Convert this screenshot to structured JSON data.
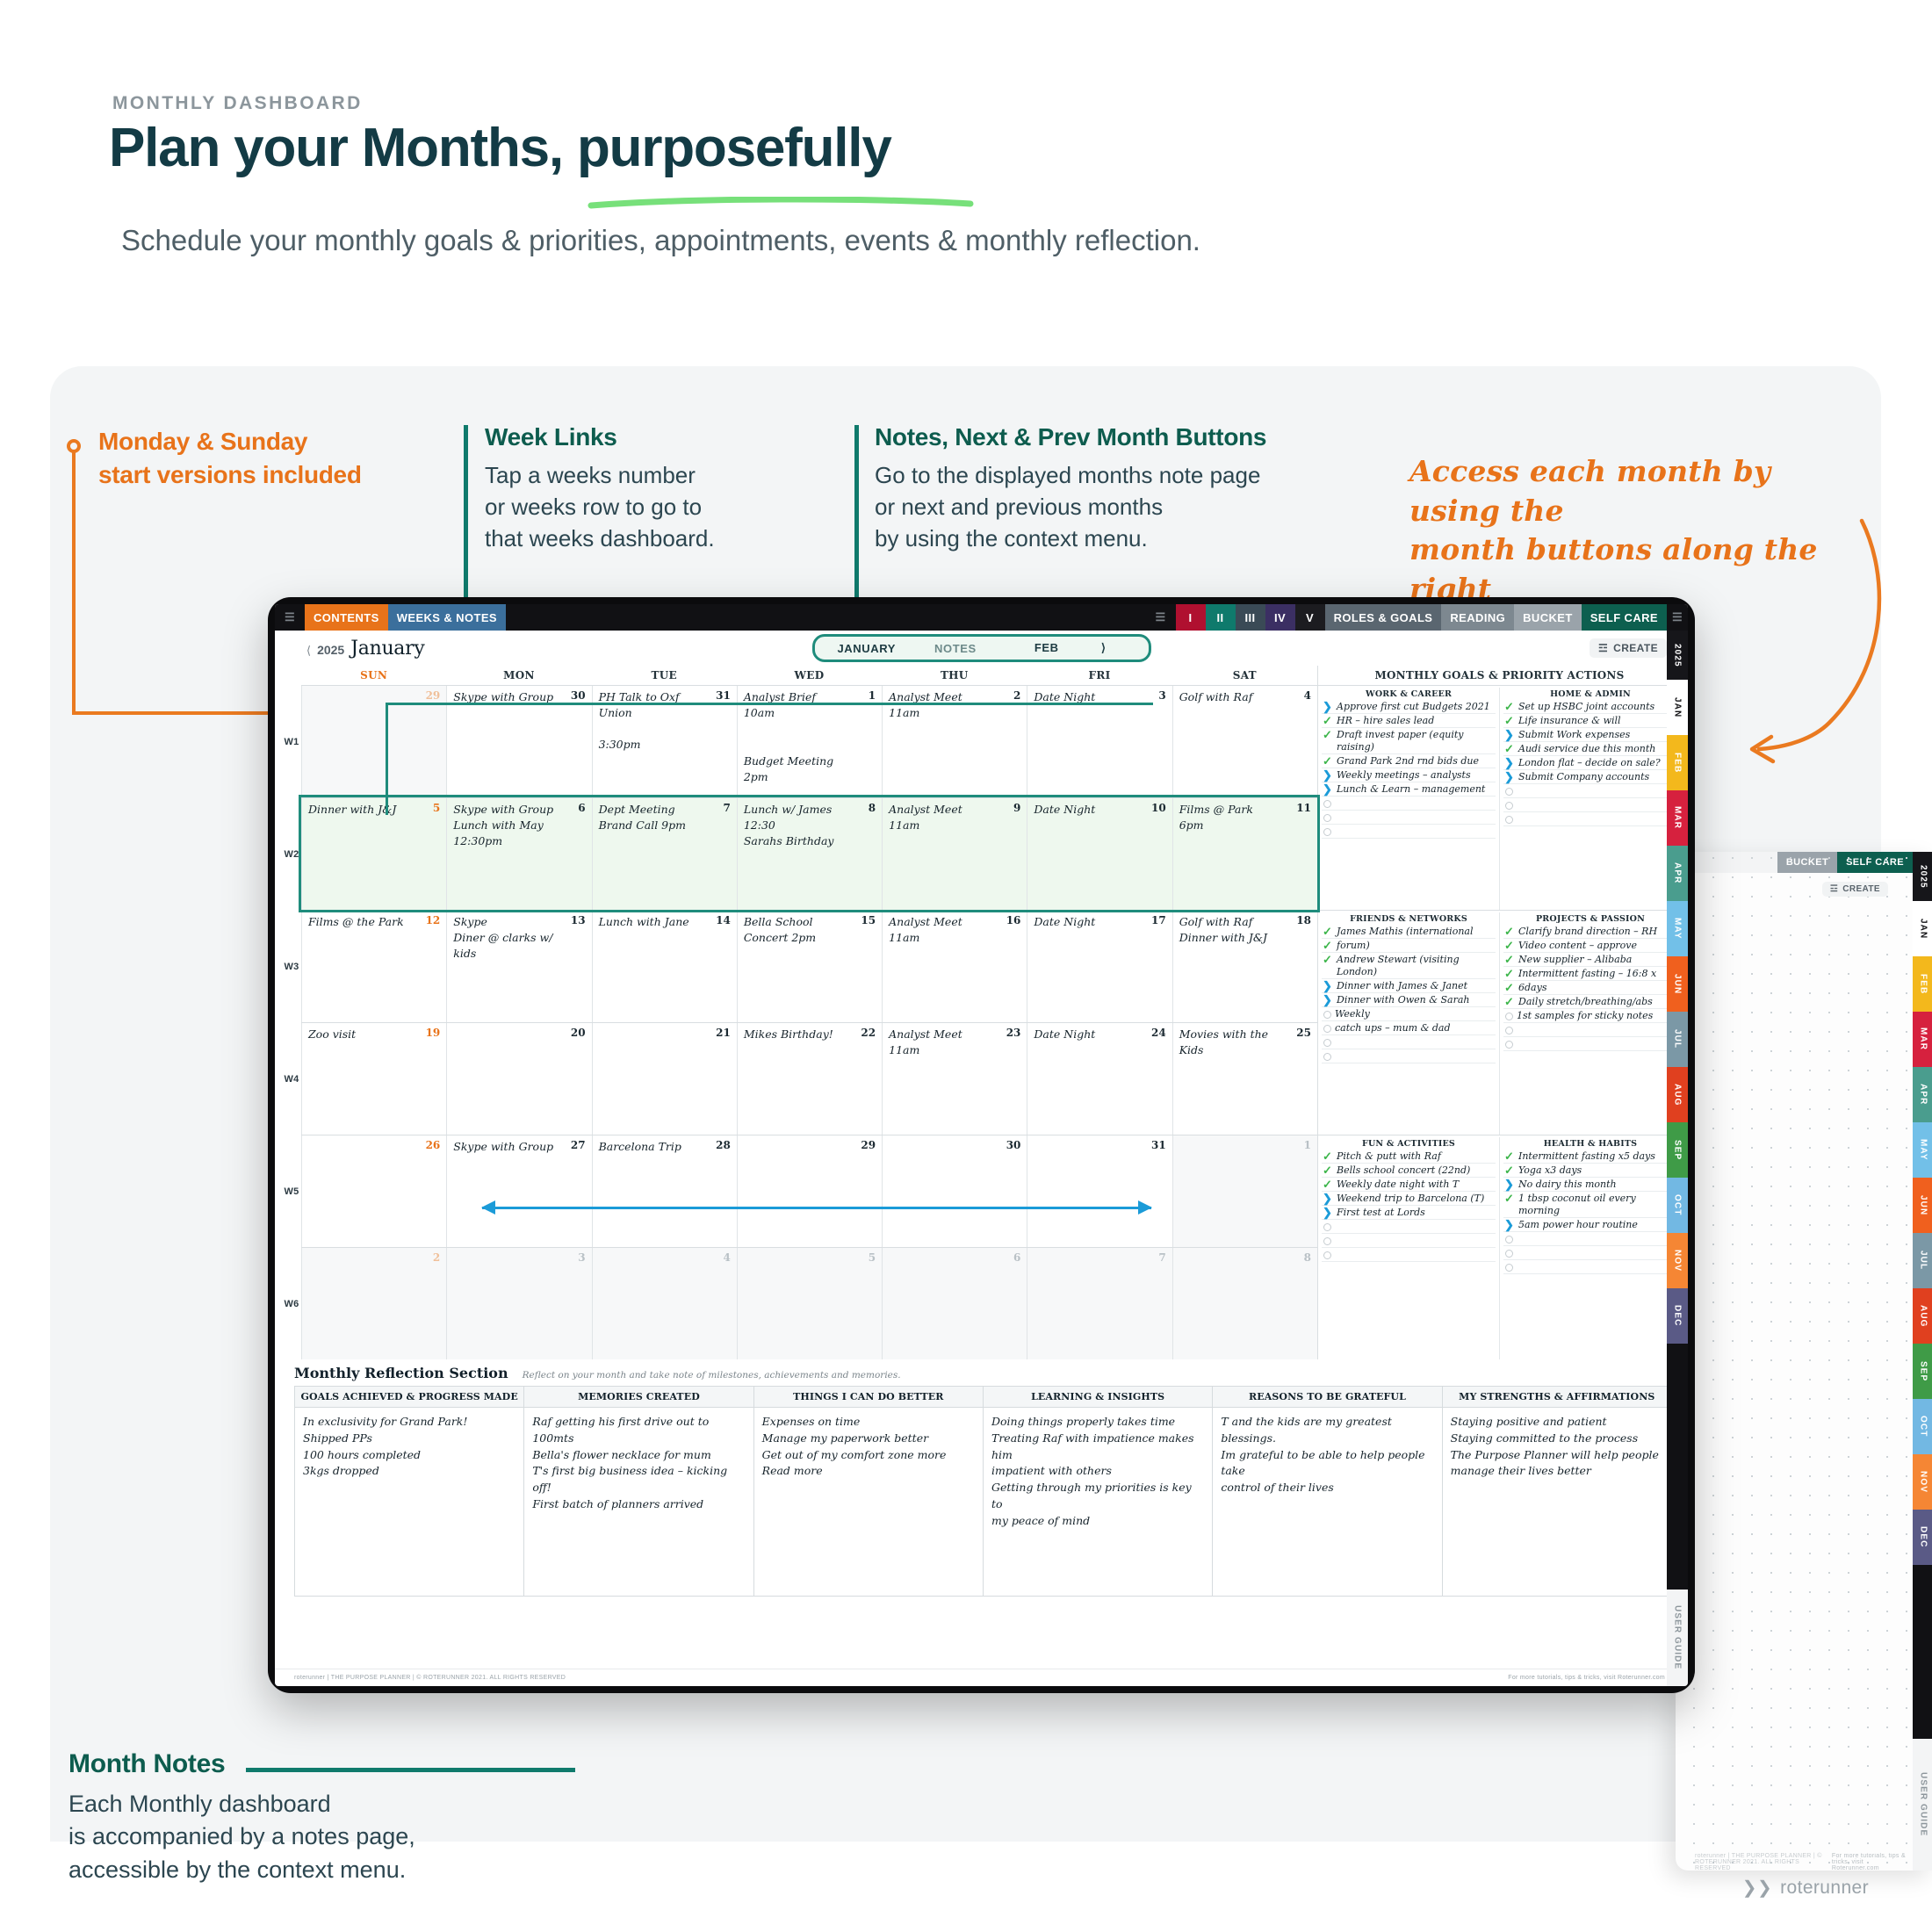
{
  "header": {
    "eyebrow": "MONTHLY DASHBOARD",
    "title": "Plan your Months, purposefully",
    "subtitle": "Schedule your monthly goals & priorities, appointments, events & monthly reflection."
  },
  "callouts": {
    "monday_sunday": {
      "title": "Monday & Sunday\nstart versions included",
      "color": "#e8731a"
    },
    "week_links": {
      "title": "Week Links",
      "body": "Tap a weeks number\nor weeks row to go to\nthat weeks dashboard."
    },
    "notes_buttons": {
      "title": "Notes, Next & Prev Month Buttons",
      "body": "Go to the displayed months note page\nor next and previous months\nby using the context menu."
    },
    "month_access": "Access each month by using the\nmonth buttons along the right",
    "month_notes": {
      "title": "Month Notes",
      "body": "Each Monthly dashboard\nis accompanied by a notes page,\naccessible by the context menu."
    }
  },
  "toolbar": {
    "menu_icon": "hamburger-icon",
    "contents": "CONTENTS",
    "weeks_notes": "WEEKS & NOTES",
    "list_icon": "list-icon",
    "numerals": [
      "I",
      "II",
      "III",
      "IV",
      "V"
    ],
    "roles_goals": "ROLES & GOALS",
    "reading": "READING",
    "bucket": "BUCKET",
    "self_care": "SELF CARE",
    "right_icon": "pages-icon",
    "colors": {
      "contents": "#e8731a",
      "weeks_notes": "#3b6f9c",
      "i": "#b01030",
      "ii": "#0f7a6c",
      "iii": "#3a4a56",
      "iv": "#3b2f63",
      "v": "#1c1c20",
      "roles_goals": "#5a6670",
      "reading": "#7d8890",
      "bucket": "#9aa3aa",
      "self_care": "#0d5f4f"
    }
  },
  "app_header": {
    "year": "2025",
    "year_prev_icon": "chevron-left-icon",
    "month": "January",
    "ctx_current": "JANUARY",
    "ctx_notes": "NOTES",
    "ctx_next": "FEB",
    "ctx_next_icon": "chevron-right-icon",
    "create_label": "CREATE",
    "create_icon": "create-icon"
  },
  "calendar": {
    "day_headers": [
      "SUN",
      "MON",
      "TUE",
      "WED",
      "THU",
      "FRI",
      "SAT"
    ],
    "week_labels": [
      "W1",
      "W2",
      "W3",
      "W4",
      "W5",
      "W6"
    ],
    "weeks": [
      {
        "label": "W1",
        "highlight": false,
        "days": [
          {
            "n": "29",
            "muted": true,
            "events": ""
          },
          {
            "n": "30",
            "muted": false,
            "events": "Skype with Group"
          },
          {
            "n": "31",
            "muted": false,
            "events": "PH Talk to Oxf\nUnion\n\n3:30pm"
          },
          {
            "n": "1",
            "muted": false,
            "events": "Analyst Brief\n10am\n\n\nBudget Meeting 2pm"
          },
          {
            "n": "2",
            "muted": false,
            "events": "Analyst Meet\n11am"
          },
          {
            "n": "3",
            "muted": false,
            "events": "Date Night"
          },
          {
            "n": "4",
            "muted": false,
            "events": "Golf with Raf"
          }
        ]
      },
      {
        "label": "W2",
        "highlight": true,
        "days": [
          {
            "n": "5",
            "muted": false,
            "events": "Dinner with J&J"
          },
          {
            "n": "6",
            "muted": false,
            "events": "Skype with Group\nLunch with May\n12:30pm"
          },
          {
            "n": "7",
            "muted": false,
            "events": "Dept Meeting\nBrand Call 9pm"
          },
          {
            "n": "8",
            "muted": false,
            "events": "Lunch w/ James\n12:30\nSarahs Birthday"
          },
          {
            "n": "9",
            "muted": false,
            "events": "Analyst Meet\n11am"
          },
          {
            "n": "10",
            "muted": false,
            "events": "Date Night"
          },
          {
            "n": "11",
            "muted": false,
            "events": "Films @ Park\n6pm"
          }
        ]
      },
      {
        "label": "W3",
        "highlight": false,
        "days": [
          {
            "n": "12",
            "muted": false,
            "events": "Films @ the Park"
          },
          {
            "n": "13",
            "muted": false,
            "events": "Skype\nDiner @ clarks w/\nkids"
          },
          {
            "n": "14",
            "muted": false,
            "events": "Lunch with Jane"
          },
          {
            "n": "15",
            "muted": false,
            "events": "Bella School\nConcert 2pm"
          },
          {
            "n": "16",
            "muted": false,
            "events": "Analyst Meet\n11am"
          },
          {
            "n": "17",
            "muted": false,
            "events": "Date Night"
          },
          {
            "n": "18",
            "muted": false,
            "events": "Golf with Raf\nDinner with J&J"
          }
        ]
      },
      {
        "label": "W4",
        "highlight": false,
        "days": [
          {
            "n": "19",
            "muted": false,
            "events": "Zoo visit"
          },
          {
            "n": "20",
            "muted": false,
            "events": ""
          },
          {
            "n": "21",
            "muted": false,
            "events": ""
          },
          {
            "n": "22",
            "muted": false,
            "events": "Mikes Birthday!"
          },
          {
            "n": "23",
            "muted": false,
            "events": "Analyst Meet\n11am"
          },
          {
            "n": "24",
            "muted": false,
            "events": "Date Night"
          },
          {
            "n": "25",
            "muted": false,
            "events": "Movies with the\nKids"
          }
        ]
      },
      {
        "label": "W5",
        "highlight": false,
        "days": [
          {
            "n": "26",
            "muted": false,
            "events": ""
          },
          {
            "n": "27",
            "muted": false,
            "events": "Skype with Group"
          },
          {
            "n": "28",
            "muted": false,
            "events": "Barcelona Trip"
          },
          {
            "n": "29",
            "muted": false,
            "events": ""
          },
          {
            "n": "30",
            "muted": false,
            "events": ""
          },
          {
            "n": "31",
            "muted": false,
            "events": ""
          },
          {
            "n": "1",
            "muted": true,
            "events": ""
          }
        ]
      },
      {
        "label": "W6",
        "highlight": false,
        "days": [
          {
            "n": "2",
            "muted": true,
            "events": ""
          },
          {
            "n": "3",
            "muted": true,
            "events": ""
          },
          {
            "n": "4",
            "muted": true,
            "events": ""
          },
          {
            "n": "5",
            "muted": true,
            "events": ""
          },
          {
            "n": "6",
            "muted": true,
            "events": ""
          },
          {
            "n": "7",
            "muted": true,
            "events": ""
          },
          {
            "n": "8",
            "muted": true,
            "events": ""
          }
        ]
      }
    ]
  },
  "goals": {
    "title": "MONTHLY GOALS & PRIORITY ACTIONS",
    "blocks": [
      {
        "columns": [
          {
            "heading": "WORK & CAREER",
            "items": [
              {
                "mark": "arrow",
                "text": "Approve first cut Budgets 2021"
              },
              {
                "mark": "check",
                "text": "HR – hire sales lead"
              },
              {
                "mark": "check",
                "text": "Draft invest paper (equity raising)"
              },
              {
                "mark": "check",
                "text": "Grand Park 2nd rnd bids due"
              },
              {
                "mark": "arrow",
                "text": "Weekly meetings – analysts"
              },
              {
                "mark": "arrow",
                "text": "Lunch & Learn – management"
              },
              {
                "mark": "circle",
                "text": ""
              },
              {
                "mark": "circle",
                "text": ""
              },
              {
                "mark": "circle",
                "text": ""
              }
            ]
          },
          {
            "heading": "HOME & ADMIN",
            "items": [
              {
                "mark": "check",
                "text": "Set up HSBC joint accounts"
              },
              {
                "mark": "check",
                "text": "Life insurance & will"
              },
              {
                "mark": "arrow",
                "text": "Submit Work expenses"
              },
              {
                "mark": "check",
                "text": "Audi service due this month"
              },
              {
                "mark": "arrow",
                "text": "London flat – decide on sale?"
              },
              {
                "mark": "arrow",
                "text": "Submit Company accounts"
              },
              {
                "mark": "circle",
                "text": ""
              },
              {
                "mark": "circle",
                "text": ""
              },
              {
                "mark": "circle",
                "text": ""
              }
            ]
          }
        ]
      },
      {
        "columns": [
          {
            "heading": "FRIENDS & NETWORKS",
            "items": [
              {
                "mark": "check",
                "text": "James Mathis (international"
              },
              {
                "mark": "check",
                "text": "forum)"
              },
              {
                "mark": "check",
                "text": "Andrew Stewart (visiting London)"
              },
              {
                "mark": "arrow",
                "text": "Dinner with James & Janet"
              },
              {
                "mark": "arrow",
                "text": "Dinner with Owen & Sarah"
              },
              {
                "mark": "circle",
                "text": "Weekly"
              },
              {
                "mark": "circle",
                "text": "catch ups – mum & dad"
              },
              {
                "mark": "circle",
                "text": ""
              },
              {
                "mark": "circle",
                "text": ""
              }
            ]
          },
          {
            "heading": "PROJECTS & PASSION",
            "items": [
              {
                "mark": "check",
                "text": "Clarify brand direction – RH"
              },
              {
                "mark": "check",
                "text": "Video content – approve"
              },
              {
                "mark": "check",
                "text": "New supplier – Alibaba"
              },
              {
                "mark": "check",
                "text": "Intermittent fasting – 16:8 x"
              },
              {
                "mark": "check",
                "text": "6days"
              },
              {
                "mark": "check",
                "text": "Daily stretch/breathing/abs"
              },
              {
                "mark": "circle",
                "text": "1st samples for sticky notes"
              },
              {
                "mark": "circle",
                "text": ""
              },
              {
                "mark": "circle",
                "text": ""
              }
            ]
          }
        ]
      },
      {
        "columns": [
          {
            "heading": "FUN & ACTIVITIES",
            "items": [
              {
                "mark": "check",
                "text": "Pitch & putt with Raf"
              },
              {
                "mark": "check",
                "text": "Bells school concert (22nd)"
              },
              {
                "mark": "check",
                "text": "Weekly date night with T"
              },
              {
                "mark": "arrow",
                "text": "Weekend trip to Barcelona (T)"
              },
              {
                "mark": "arrow",
                "text": "First test at Lords"
              },
              {
                "mark": "circle",
                "text": ""
              },
              {
                "mark": "circle",
                "text": ""
              },
              {
                "mark": "circle",
                "text": ""
              }
            ]
          },
          {
            "heading": "HEALTH & HABITS",
            "items": [
              {
                "mark": "check",
                "text": "Intermittent fasting x5 days"
              },
              {
                "mark": "check",
                "text": "Yoga x3 days"
              },
              {
                "mark": "arrow",
                "text": "No dairy this month"
              },
              {
                "mark": "check",
                "text": "1 tbsp coconut oil every morning"
              },
              {
                "mark": "arrow",
                "text": "5am power hour routine"
              },
              {
                "mark": "circle",
                "text": ""
              },
              {
                "mark": "circle",
                "text": ""
              },
              {
                "mark": "circle",
                "text": ""
              }
            ]
          }
        ]
      }
    ]
  },
  "reflection": {
    "title": "Monthly Reflection Section",
    "subtitle": "Reflect on your month and take note of milestones, achievements and memories.",
    "columns": [
      {
        "heading": "GOALS ACHIEVED & PROGRESS MADE",
        "body": "In exclusivity for Grand Park!\nShipped PPs\n100 hours completed\n3kgs dropped"
      },
      {
        "heading": "MEMORIES CREATED",
        "body": "Raf getting his first drive out to\n100mts\nBella's flower necklace for mum\nT's first big business idea – kicking off!\nFirst batch of planners arrived"
      },
      {
        "heading": "THINGS I CAN DO BETTER",
        "body": "Expenses on time\nManage my paperwork better\nGet out of my comfort zone more\nRead more"
      },
      {
        "heading": "LEARNING & INSIGHTS",
        "body": "Doing things properly takes time\nTreating Raf with impatience makes him\nimpatient with others\nGetting through my priorities is key to\nmy peace of mind"
      },
      {
        "heading": "REASONS TO BE GRATEFUL",
        "body": "T and the kids are my greatest blessings.\nIm grateful to be able to help people take\ncontrol of their lives"
      },
      {
        "heading": "MY STRENGTHS & AFFIRMATIONS",
        "body": "Staying positive and patient\nStaying committed to the process\nThe Purpose Planner will help people\nmanage their lives better"
      }
    ]
  },
  "app_footer": {
    "left": "roterunner  |  THE PURPOSE PLANNER  |  © ROTERUNNER 2021. ALL RIGHTS RESERVED",
    "right": "For more tutorials, tips & tricks, visit Roterunner.com"
  },
  "month_tabs": {
    "year": "2025",
    "months": [
      {
        "label": "JAN",
        "color": "#ffffff",
        "text": "#111114"
      },
      {
        "label": "FEB",
        "color": "#f3b81c",
        "text": "#ffffff"
      },
      {
        "label": "MAR",
        "color": "#d6213e",
        "text": "#ffffff"
      },
      {
        "label": "APR",
        "color": "#4a9d8e",
        "text": "#ffffff"
      },
      {
        "label": "MAY",
        "color": "#72c0e8",
        "text": "#ffffff"
      },
      {
        "label": "JUN",
        "color": "#f0601e",
        "text": "#ffffff"
      },
      {
        "label": "JUL",
        "color": "#7b98a6",
        "text": "#ffffff"
      },
      {
        "label": "AUG",
        "color": "#e0401f",
        "text": "#ffffff"
      },
      {
        "label": "SEP",
        "color": "#3f9b47",
        "text": "#ffffff"
      },
      {
        "label": "OCT",
        "color": "#72b8e3",
        "text": "#ffffff"
      },
      {
        "label": "NOV",
        "color": "#f58634",
        "text": "#ffffff"
      },
      {
        "label": "DEC",
        "color": "#5a5a86",
        "text": "#ffffff"
      }
    ],
    "user_guide": "USER GUIDE"
  },
  "page2": {
    "bucket": "BUCKET",
    "self_care": "SELF CARE",
    "create": "CREATE",
    "year": "2025",
    "user_guide": "USER GUIDE",
    "footer_right": "For more tutorials, tips & tricks, visit Roterunner.com"
  },
  "brand": {
    "name": "roterunner"
  }
}
